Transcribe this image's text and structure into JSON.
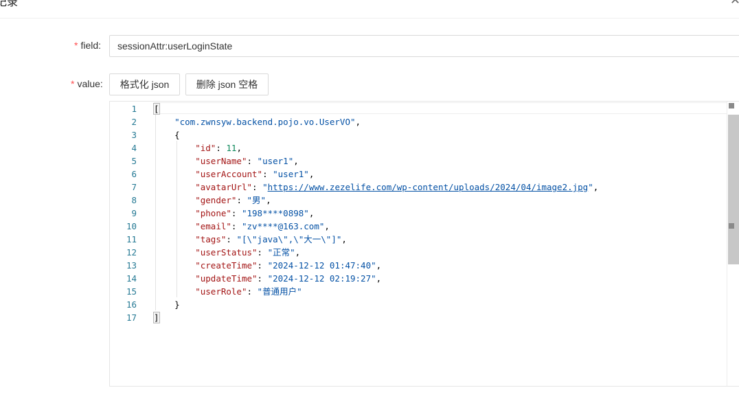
{
  "dialog": {
    "title": "记录",
    "close_icon": "close-icon"
  },
  "form": {
    "field_label": "field:",
    "field_value": "sessionAttr:userLoginState",
    "value_label": "value:",
    "required_mark": "*"
  },
  "toolbar": {
    "format_label": "格式化 json",
    "strip_label": "删除 json 空格"
  },
  "editor": {
    "line_numbers": [
      "1",
      "2",
      "3",
      "4",
      "5",
      "6",
      "7",
      "8",
      "9",
      "10",
      "11",
      "12",
      "13",
      "14",
      "15",
      "16",
      "17"
    ],
    "lines": [
      [
        {
          "c": "p",
          "t": "["
        }
      ],
      [
        {
          "c": "p",
          "t": "    "
        },
        {
          "c": "s",
          "t": "\"com.zwnsyw.backend.pojo.vo.UserVO\""
        },
        {
          "c": "p",
          "t": ","
        }
      ],
      [
        {
          "c": "p",
          "t": "    {"
        }
      ],
      [
        {
          "c": "p",
          "t": "        "
        },
        {
          "c": "k",
          "t": "\"id\""
        },
        {
          "c": "p",
          "t": ": "
        },
        {
          "c": "n",
          "t": "11"
        },
        {
          "c": "p",
          "t": ","
        }
      ],
      [
        {
          "c": "p",
          "t": "        "
        },
        {
          "c": "k",
          "t": "\"userName\""
        },
        {
          "c": "p",
          "t": ": "
        },
        {
          "c": "s",
          "t": "\"user1\""
        },
        {
          "c": "p",
          "t": ","
        }
      ],
      [
        {
          "c": "p",
          "t": "        "
        },
        {
          "c": "k",
          "t": "\"userAccount\""
        },
        {
          "c": "p",
          "t": ": "
        },
        {
          "c": "s",
          "t": "\"user1\""
        },
        {
          "c": "p",
          "t": ","
        }
      ],
      [
        {
          "c": "p",
          "t": "        "
        },
        {
          "c": "k",
          "t": "\"avatarUrl\""
        },
        {
          "c": "p",
          "t": ": "
        },
        {
          "c": "s",
          "t": "\""
        },
        {
          "c": "s link",
          "t": "https://www.zezelife.com/wp-content/uploads/2024/04/image2.jpg"
        },
        {
          "c": "s",
          "t": "\""
        },
        {
          "c": "p",
          "t": ","
        }
      ],
      [
        {
          "c": "p",
          "t": "        "
        },
        {
          "c": "k",
          "t": "\"gender\""
        },
        {
          "c": "p",
          "t": ": "
        },
        {
          "c": "s",
          "t": "\"男\""
        },
        {
          "c": "p",
          "t": ","
        }
      ],
      [
        {
          "c": "p",
          "t": "        "
        },
        {
          "c": "k",
          "t": "\"phone\""
        },
        {
          "c": "p",
          "t": ": "
        },
        {
          "c": "s",
          "t": "\"198****0898\""
        },
        {
          "c": "p",
          "t": ","
        }
      ],
      [
        {
          "c": "p",
          "t": "        "
        },
        {
          "c": "k",
          "t": "\"email\""
        },
        {
          "c": "p",
          "t": ": "
        },
        {
          "c": "s",
          "t": "\"zv****@163.com\""
        },
        {
          "c": "p",
          "t": ","
        }
      ],
      [
        {
          "c": "p",
          "t": "        "
        },
        {
          "c": "k",
          "t": "\"tags\""
        },
        {
          "c": "p",
          "t": ": "
        },
        {
          "c": "s",
          "t": "\"[\\\"java\\\",\\\"大一\\\"]\""
        },
        {
          "c": "p",
          "t": ","
        }
      ],
      [
        {
          "c": "p",
          "t": "        "
        },
        {
          "c": "k",
          "t": "\"userStatus\""
        },
        {
          "c": "p",
          "t": ": "
        },
        {
          "c": "s",
          "t": "\"正常\""
        },
        {
          "c": "p",
          "t": ","
        }
      ],
      [
        {
          "c": "p",
          "t": "        "
        },
        {
          "c": "k",
          "t": "\"createTime\""
        },
        {
          "c": "p",
          "t": ": "
        },
        {
          "c": "s",
          "t": "\"2024-12-12 01:47:40\""
        },
        {
          "c": "p",
          "t": ","
        }
      ],
      [
        {
          "c": "p",
          "t": "        "
        },
        {
          "c": "k",
          "t": "\"updateTime\""
        },
        {
          "c": "p",
          "t": ": "
        },
        {
          "c": "s",
          "t": "\"2024-12-12 02:19:27\""
        },
        {
          "c": "p",
          "t": ","
        }
      ],
      [
        {
          "c": "p",
          "t": "        "
        },
        {
          "c": "k",
          "t": "\"userRole\""
        },
        {
          "c": "p",
          "t": ": "
        },
        {
          "c": "s",
          "t": "\"普通用户\""
        }
      ],
      [
        {
          "c": "p",
          "t": "    }"
        }
      ],
      [
        {
          "c": "p",
          "t": "]"
        }
      ]
    ]
  },
  "colors": {
    "required": "#ff4d4f",
    "line_number": "#237893",
    "json_key": "#a31515",
    "json_string": "#0451a5",
    "json_number": "#098658"
  }
}
